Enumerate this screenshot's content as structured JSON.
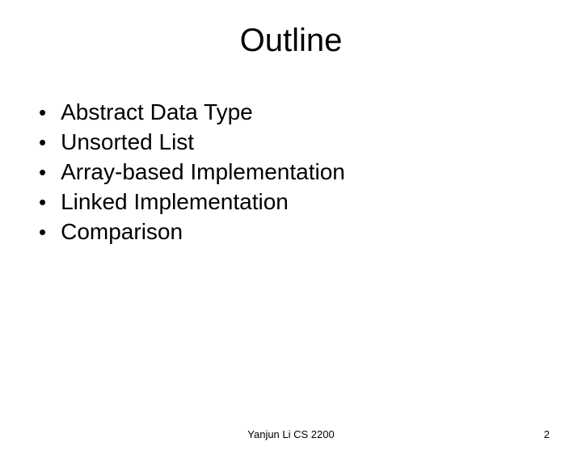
{
  "title": "Outline",
  "bullets": {
    "item0": "Abstract Data Type",
    "item1": "Unsorted List",
    "item2": "Array-based Implementation",
    "item3": "Linked Implementation",
    "item4": "Comparison"
  },
  "footer": {
    "center": "Yanjun Li CS 2200",
    "pageNumber": "2"
  }
}
